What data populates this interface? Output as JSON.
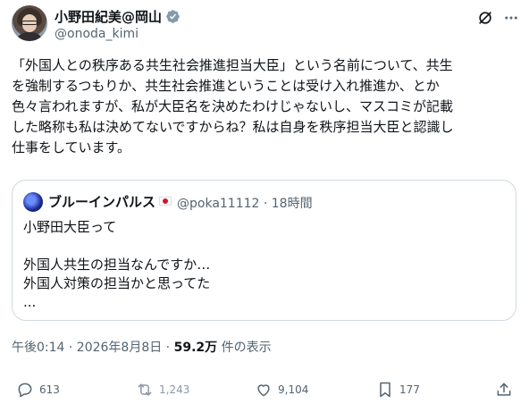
{
  "author": {
    "display_name": "小野田紀美@岡山",
    "handle": "@onoda_kimi"
  },
  "tweet": {
    "text": "「外国人との秩序ある共生社会推進担当大臣」という名前について、共生\nを強制するつもりか、共生社会推進ということは受け入れ推進か、とか\n色々言われますが、私が大臣名を決めたわけじゃないし、マスコミが記載\nした略称も私は決めてないですからね？私は自身を秩序担当大臣と認識し\n仕事をしています。"
  },
  "quote": {
    "display_name": "ブルーインパルス",
    "meta": "@poka11112 · 18時間",
    "text": "小野田大臣って\n\n外国人共生の担当なんですか…\n外国人対策の担当かと思ってた\n..."
  },
  "meta": {
    "time": "午後0:14 · 2026年8月8日 · ",
    "views": "59.2万",
    "views_label": " 件の表示"
  },
  "actions": {
    "replies": "613",
    "retweets": "1,243",
    "likes": "9,104",
    "bookmarks": "177"
  },
  "colors": {
    "text_primary": "#0f1419",
    "text_secondary": "#536471",
    "border": "#cfd9de",
    "verified": "#829aab"
  }
}
